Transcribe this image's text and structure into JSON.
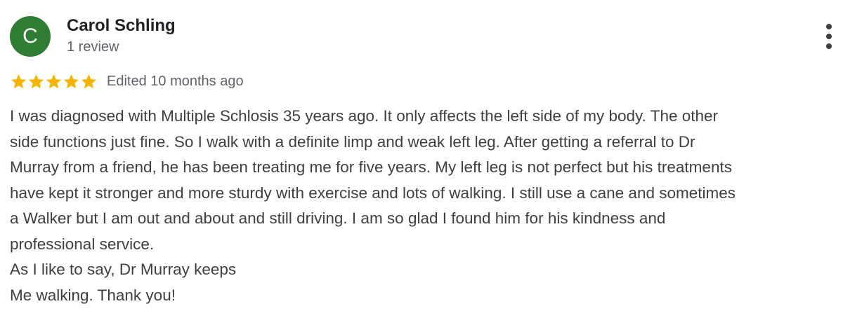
{
  "reviewer": {
    "avatar_initial": "C",
    "avatar_color": "#2e7d32",
    "name": "Carol Schling",
    "review_count": "1 review"
  },
  "menu": {
    "icon": "more-vert-icon"
  },
  "rating": {
    "stars": 5,
    "max_stars": 5,
    "star_color": "#f4b400",
    "icon": "star-icon",
    "time": "Edited 10 months ago"
  },
  "review": {
    "lines": [
      "I was diagnosed with Multiple Schlosis 35 years ago. It only affects the left side of my body. The other",
      "side functions just fine. So I walk with a definite limp and weak left leg. After getting a referral to Dr",
      "Murray from a friend, he has been treating me for five years. My left leg is not perfect but his treatments",
      "have kept it stronger and more sturdy with exercise and lots of walking. I still use a cane and sometimes",
      "a Walker but I am out and about and still driving. I am so glad I found him for his kindness and",
      "professional service.",
      "As I like to say, Dr Murray keeps",
      "Me walking. Thank you!"
    ]
  }
}
